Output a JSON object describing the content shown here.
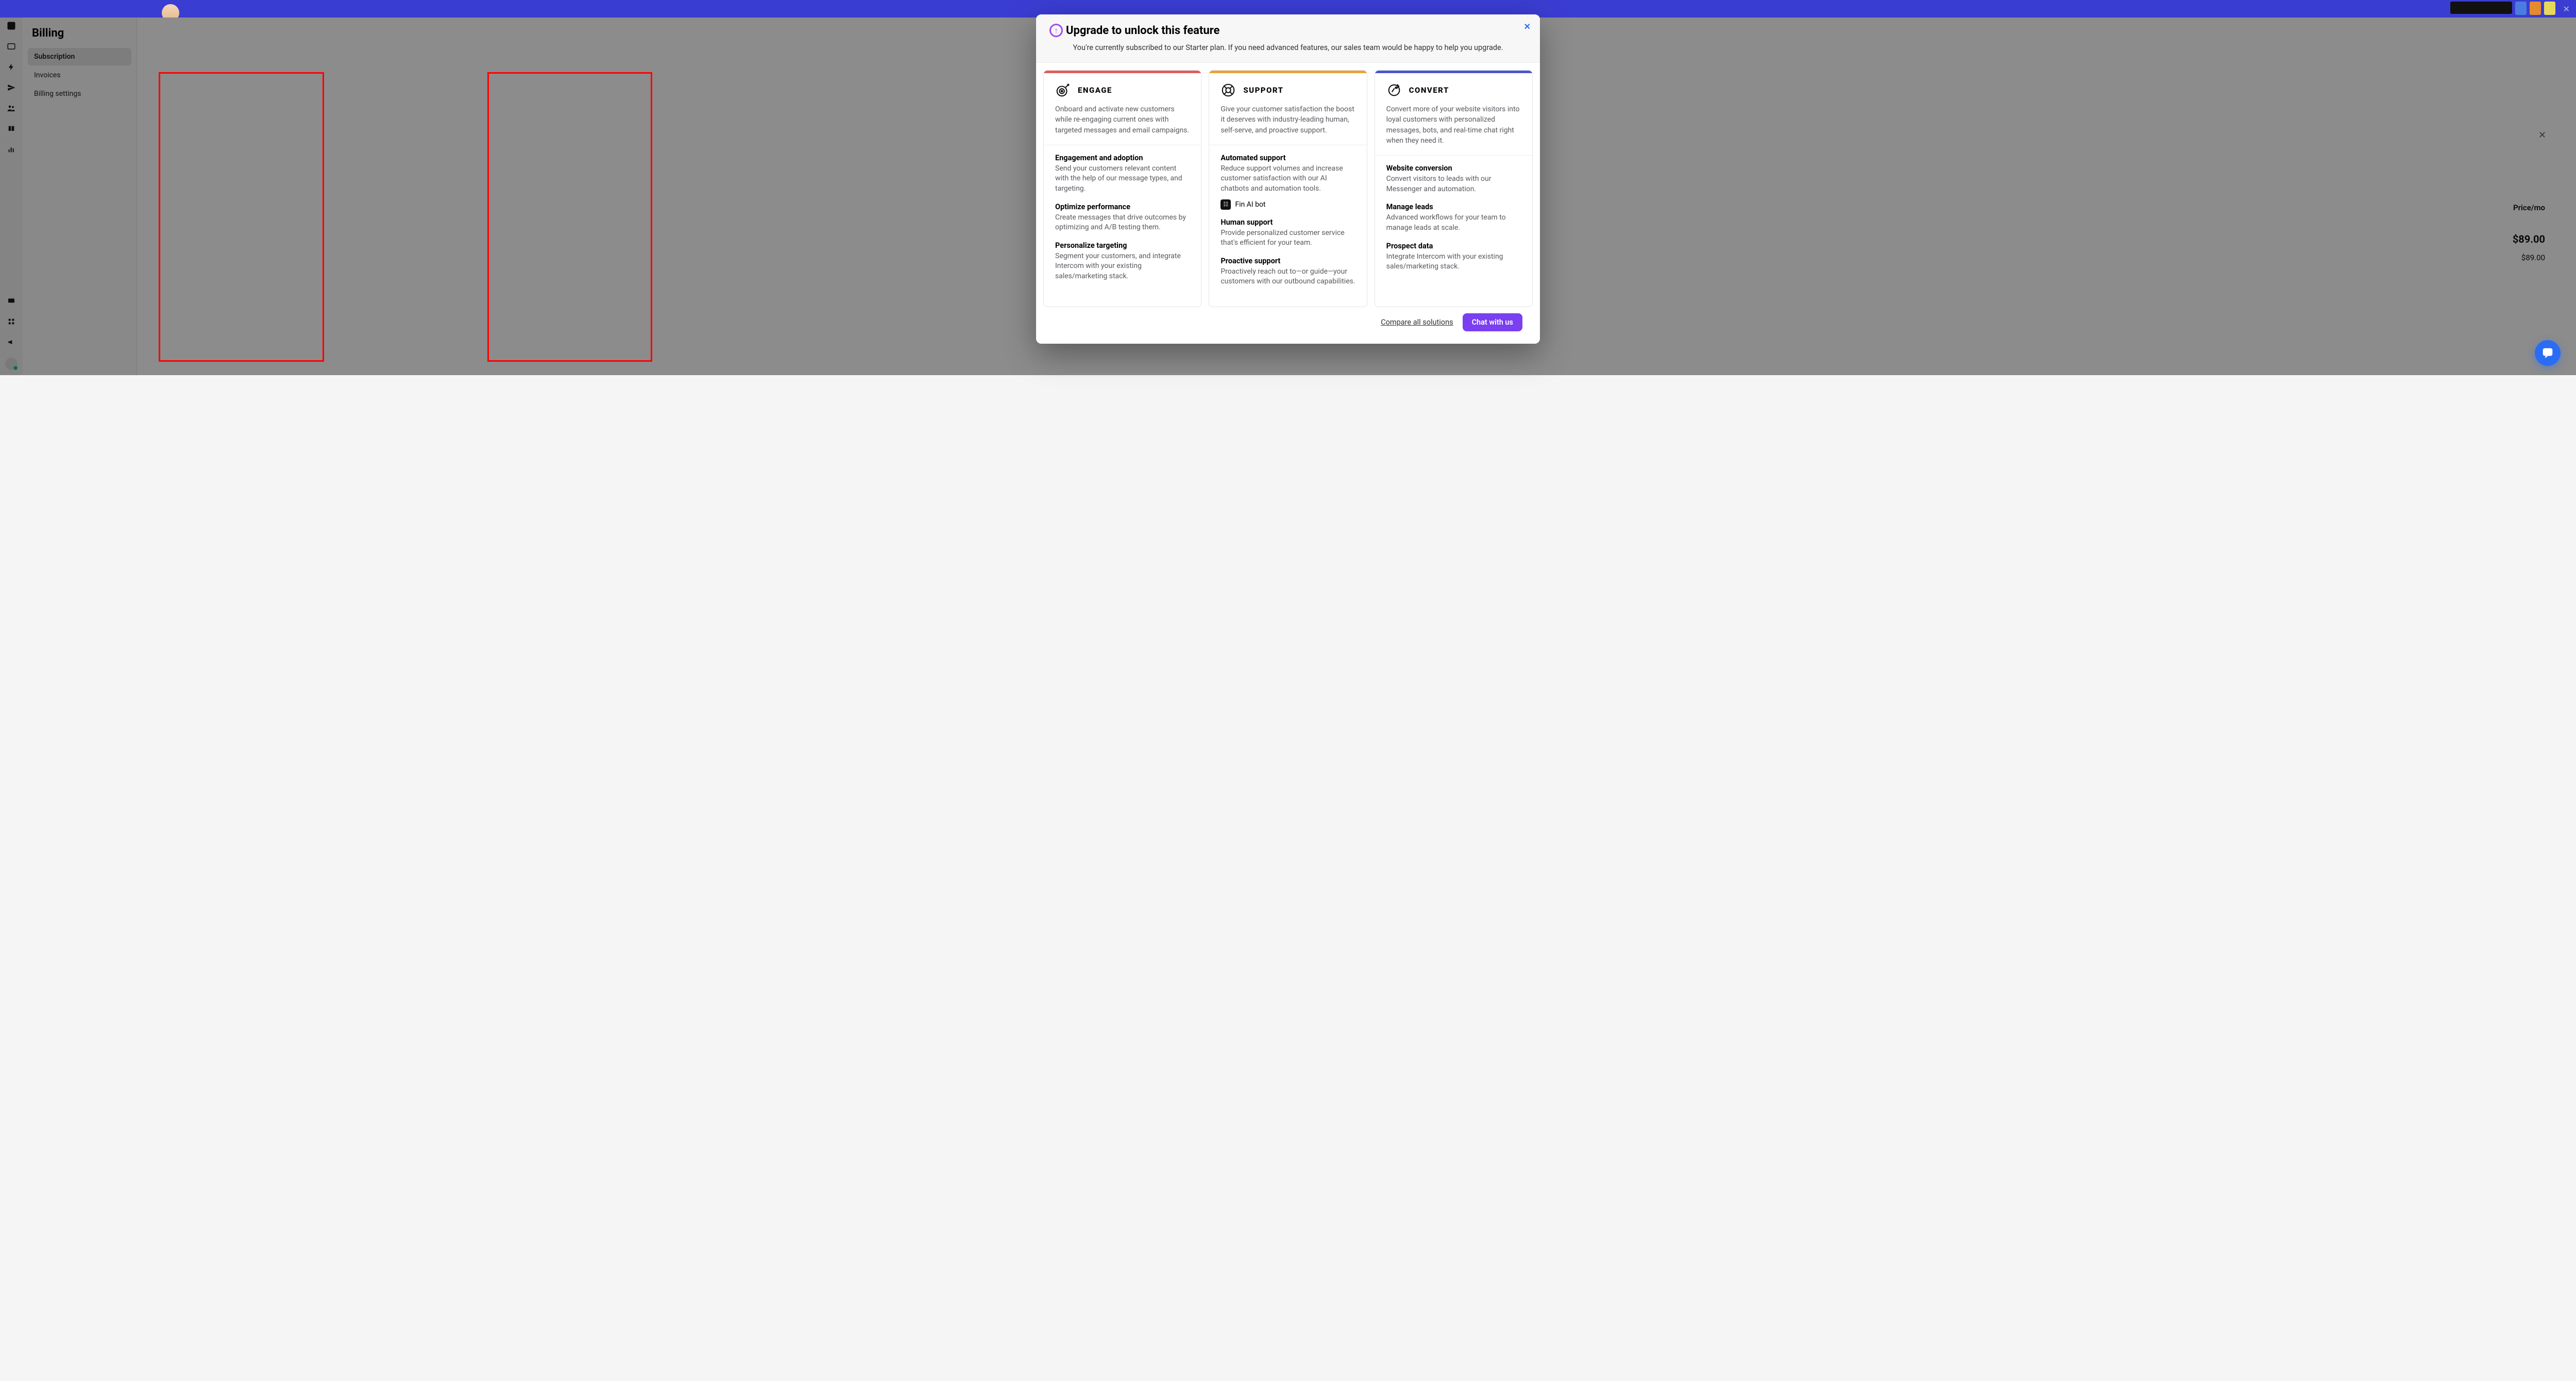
{
  "page": {
    "title": "Billing"
  },
  "sidebar_nav": {
    "items": [
      {
        "label": "Subscription",
        "active": true
      },
      {
        "label": "Invoices",
        "active": false
      },
      {
        "label": "Billing settings",
        "active": false
      }
    ]
  },
  "underlying": {
    "price_header": "Price/mo",
    "price_main": "$89.00",
    "price_sub": "$89.00"
  },
  "modal": {
    "title": "Upgrade to unlock this feature",
    "subtitle": "You're currently subscribed to our Starter plan. If you need advanced features, our sales team would be happy to help you upgrade.",
    "compare": "Compare all solutions",
    "chat": "Chat with us",
    "cards": {
      "engage": {
        "title": "ENGAGE",
        "desc": "Onboard and activate new customers while re-engaging current ones with targeted messages and email campaigns.",
        "features": [
          {
            "h": "Engagement and adoption",
            "p": "Send your customers relevant content with the help of our message types, and targeting."
          },
          {
            "h": "Optimize performance",
            "p": "Create messages that drive outcomes by optimizing and A/B testing them."
          },
          {
            "h": "Personalize targeting",
            "p": "Segment your customers, and integrate Intercom with your existing sales/marketing stack."
          }
        ]
      },
      "support": {
        "title": "SUPPORT",
        "desc": "Give your customer satisfaction the boost it deserves with industry-leading human, self-serve, and proactive support.",
        "fin_label": "Fin AI bot",
        "features": [
          {
            "h": "Automated support",
            "p": "Reduce support volumes and increase customer satisfaction with our AI chatbots and automation tools."
          },
          {
            "h": "Human support",
            "p": "Provide personalized customer service that's efficient for your team."
          },
          {
            "h": "Proactive support",
            "p": "Proactively reach out to—or guide—your customers with our outbound capabilities."
          }
        ]
      },
      "convert": {
        "title": "CONVERT",
        "desc": "Convert more of your website visitors into loyal customers with personalized messages, bots, and real-time chat right when they need it.",
        "features": [
          {
            "h": "Website conversion",
            "p": "Convert visitors to leads with our Messenger and automation."
          },
          {
            "h": "Manage leads",
            "p": "Advanced workflows for your team to manage leads at scale."
          },
          {
            "h": "Prospect data",
            "p": "Integrate Intercom with your existing sales/marketing stack."
          }
        ]
      }
    }
  }
}
